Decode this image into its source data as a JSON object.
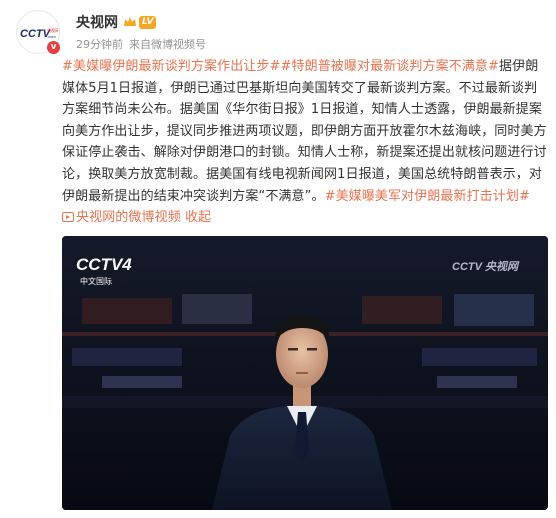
{
  "post": {
    "author": "央视网",
    "level": "LV",
    "time": "29分钟前",
    "source_prefix": "来自",
    "source": "微博视频号",
    "tag1": "#美媒曝伊朗最新谈判方案作出让步#",
    "tag2": "#特朗普被曝对最新谈判方案不满意#",
    "body": "据伊朗媒体5月1日报道，伊朗已通过巴基斯坦向美国转交了最新谈判方案。不过最新谈判方案细节尚未公布。据美国《华尔街日报》1日报道，知情人士透露，伊朗最新提案向美方作出让步，提议同步推进两项议题，即伊朗方面开放霍尔木兹海峡，同时美方保证停止袭击、解除对伊朗港口的封锁。知情人士称，新提案还提出就核问题进行讨论，换取美方放宽制裁。据美国有线电视新闻网1日报道，美国总统特朗普表示，对伊朗最新提出的结束冲突谈判方案“不满意”。",
    "tag3": "#美媒曝美军对伊朗最新打击计划#",
    "video_link": "央视网的微博视频",
    "collapse": "收起"
  },
  "video": {
    "channel_logo_top": "CCTV4",
    "channel_logo_bottom": "中文国际",
    "watermark": "CCTV 央视网"
  },
  "colors": {
    "accent": "#eb7350",
    "badge_red": "#e83e3e",
    "level_orange": "#f5a623"
  }
}
